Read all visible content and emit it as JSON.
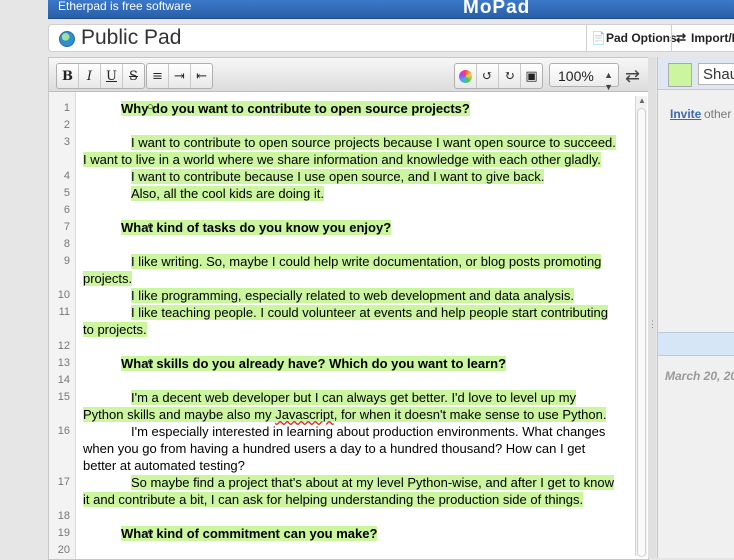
{
  "banner": {
    "tagline": "Etherpad is free software",
    "brand": "MoPad"
  },
  "titlebar": {
    "title": "Public Pad",
    "pad_options": "Pad Options",
    "import_export": "Import/Ex"
  },
  "toolbar": {
    "bold": "B",
    "italic": "I",
    "underline": "U",
    "strike": "S",
    "zoom": "100%"
  },
  "editor": {
    "line_numbers": [
      "1",
      "2",
      "3",
      "4",
      "5",
      "6",
      "7",
      "8",
      "9",
      "10",
      "11",
      "12",
      "13",
      "14",
      "15",
      "16",
      "17",
      "18",
      "19",
      "20"
    ],
    "lines": [
      "Why do you want to contribute to open source projects?",
      "I want to contribute to open source projects because I want open source to succeed.",
      "I want to live in a world where we share information and knowledge with each other gladly.",
      "I want to contribute because I use open source, and I want to give back.",
      "Also, all the cool kids are doing it.",
      "What kind of tasks do you know you enjoy?",
      "I like writing.  So, maybe I could help write documentation, or blog posts promoting",
      "projects.",
      "I like programming, especially related to web development and data analysis.",
      "I like teaching people.  I could volunteer at events and help people start contributing",
      "to projects.",
      "What skills do you already have?  Which do you want to learn?",
      "I'm a decent web developer but I can always get better.  I'd love to level up my",
      "Python skills and maybe also my ",
      "Javascript",
      ", for when it doesn't make sense to use Python.",
      "I'm especially interested in learning about production environments.  What changes",
      "when you go from having a hundred users a day to a hundred thousand?  How can I get",
      "better at automated testing?",
      "So maybe find a project that's about at my level Python-wise, and after I get to know",
      "it and contribute a bit, I can ask for helping understanding the production side of things.",
      "What kind of commitment can you make?"
    ]
  },
  "sidebar": {
    "username": "Shau",
    "invite": "Invite",
    "invite_rest": "other",
    "date": "March 20, 20"
  },
  "colors": {
    "author_highlight": "#ccf5a0",
    "banner": "#2f66b3",
    "link": "#3a6ab0"
  }
}
